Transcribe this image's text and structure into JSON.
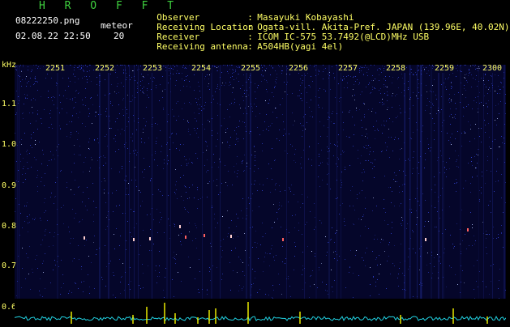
{
  "header": {
    "brand": "H R O F F T",
    "filename": "08222250.png",
    "meteor_label": "meteor",
    "datetime": "02.08.22 22:50",
    "meteor_count": "20"
  },
  "info": [
    {
      "key": "Observer",
      "value": "Masayuki Kobayashi"
    },
    {
      "key": "Receiving Location",
      "value": "Ogata-vill. Akita-Pref. JAPAN (139.96E, 40.02N)"
    },
    {
      "key": "Receiver",
      "value": "ICOM IC-575 53.7492(@LCD)MHz USB"
    },
    {
      "key": "Receiving antenna",
      "value": "A504HB(yagi 4el)"
    }
  ],
  "axis": {
    "y_unit": "kHz",
    "y_ticks": [
      "1.1",
      "1.0",
      "0.9",
      "0.8",
      "0.7",
      "0.6"
    ],
    "x_ticks": [
      "2251",
      "2252",
      "2253",
      "2254",
      "2255",
      "2256",
      "2257",
      "2258",
      "2259",
      "2300"
    ]
  },
  "colors": {
    "background": "#000000",
    "spectrogram": "#05062a",
    "noise": "#3040c8",
    "labels": "#ffff66",
    "brand": "#3fd23f",
    "trace": "#21d0e0",
    "spikes": "#e8e800"
  }
}
